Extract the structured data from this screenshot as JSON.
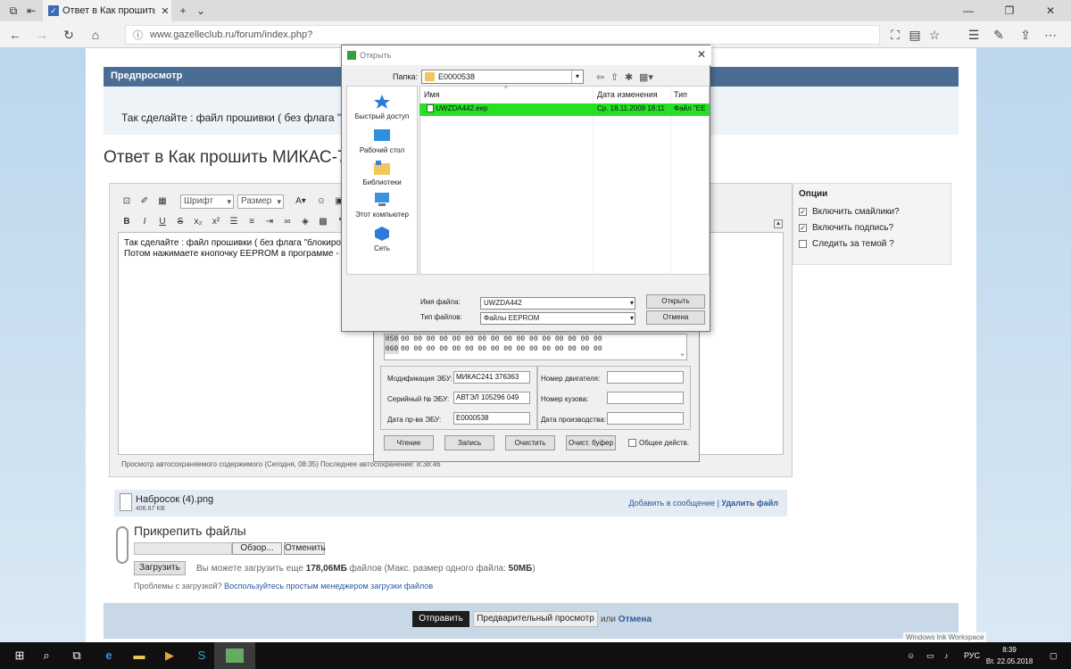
{
  "browser": {
    "tab_title": "Ответ в Как прошить М",
    "url": "www.gazelleclub.ru/forum/index.php?"
  },
  "preview": {
    "header": "Предпросмотр",
    "text": "Так сделайте : файл прошивки ( без флага \"бл"
  },
  "reply_title": "Ответ в Как прошить МИКАС-7",
  "editor": {
    "font_select": "Шрифт",
    "size_select": "Размер",
    "format_buttons": [
      "B",
      "I",
      "U",
      "S",
      "x₂",
      "x²"
    ],
    "line1": "Так сделайте : файл прошивки ( без флага \"блокиро",
    "line2": "Потом нажимаете кнопочку  EEPROM в программе -",
    "autosave": "Просмотр автосохраняемого содержимого (Сегодня, 08:35) Последнее автосохранение: 8:38:46"
  },
  "options": {
    "header": "Опции",
    "items": [
      {
        "label": "Включить смайлики?",
        "mark": "✓"
      },
      {
        "label": "Включить подпись?",
        "mark": "✓"
      },
      {
        "label": "Следить за темой ?",
        "mark": ""
      }
    ]
  },
  "attachment": {
    "name": "Набросок (4).png",
    "size": "406.67 KB",
    "add_link": "Добавить в сообщение",
    "sep": " | ",
    "delete_link": "Удалить файл"
  },
  "upload": {
    "title": "Прикрепить файлы",
    "browse": "Обзор...",
    "cancel": "Отменить",
    "upload_btn": "Загрузить",
    "note_prefix": "Вы можете загрузить еще ",
    "note_size": "178,06МБ",
    "note_mid": " файлов (Макс. размер одного файла: ",
    "note_max": "50МБ",
    "note_suffix": ")",
    "problems_prefix": "Проблемы с загрузкой? ",
    "problems_link": "Воспользуйтесь простым менеджером загрузки файлов"
  },
  "footer": {
    "submit": "Отправить",
    "preview": "Предварительный просмотр",
    "or": "или ",
    "cancel": "Отмена"
  },
  "program": {
    "hex_rows": [
      {
        "addr": "050",
        "data": "00 00 00 00 00 00 00 00 00 00 00 00 00 00 00 00"
      },
      {
        "addr": "060",
        "data": "00 00 00 00 00 00 00 00 00 00 00 00 00 00 00 00"
      }
    ],
    "mod_label": "Модификация ЭБУ:",
    "mod_value": "МИКАС241 376363",
    "serial_label": "Серийный № ЭБУ:",
    "serial_value": "АВТЭЛ 105296 049",
    "date_label": "Дата пр-ва ЭБУ:",
    "date_value": "E0000538",
    "engine_label": "Номер двигателя:",
    "body_label": "Номер кузова:",
    "prod_label": "Дата производства:",
    "btn_read": "Чтение",
    "btn_write": "Запись",
    "btn_clear": "Очистить",
    "btn_clear_buf": "Очист. буфер",
    "common_edit": "Общее действ."
  },
  "dialog": {
    "title": "Открыть",
    "folder_label": "Папка:",
    "folder_value": "E0000538",
    "places": [
      "Быстрый доступ",
      "Рабочий стол",
      "Библиотеки",
      "Этот компьютер",
      "Сеть"
    ],
    "col_name": "Имя",
    "col_date": "Дата изменения",
    "col_type": "Тип",
    "file_name": "UWZDA442.eep",
    "file_date": "Ср. 18.11.2009 18:11",
    "file_type": "Файл \"EE",
    "filename_label": "Имя файла:",
    "filename_value": "UWZDA442",
    "filetype_label": "Тип файлов:",
    "filetype_value": "Файлы EEPROM",
    "open_btn": "Открыть",
    "cancel_btn": "Отмена"
  },
  "taskbar": {
    "ink": "Windows Ink Workspace",
    "lang": "РУС",
    "time": "8:39",
    "date": "Вт. 22.05.2018"
  }
}
